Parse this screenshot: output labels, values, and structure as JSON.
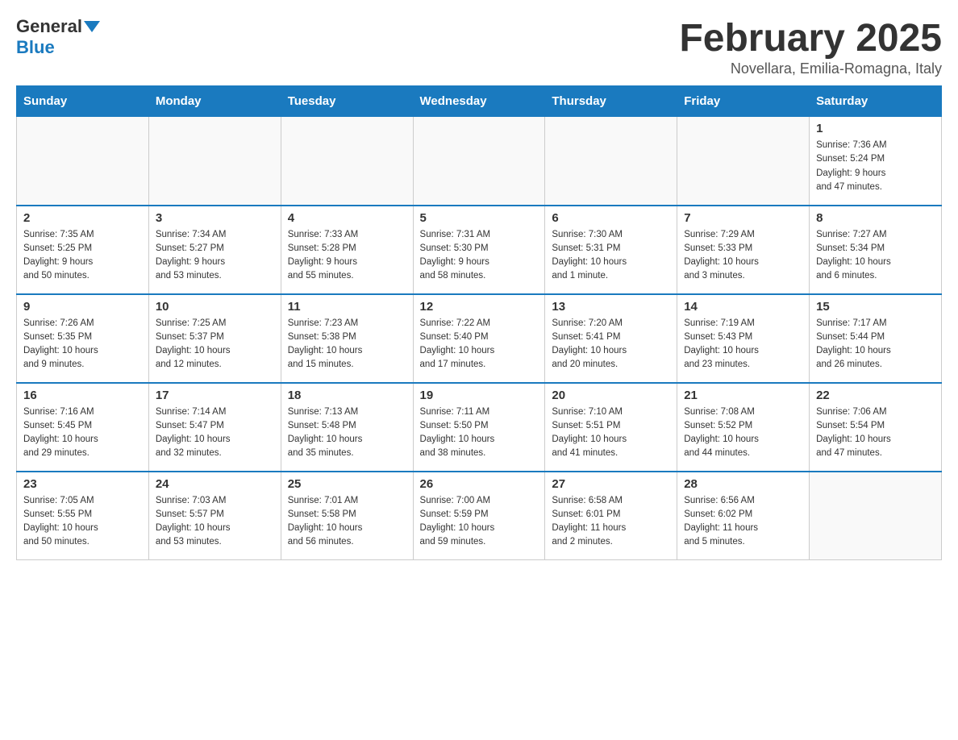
{
  "logo": {
    "general": "General",
    "blue": "Blue"
  },
  "title": "February 2025",
  "subtitle": "Novellara, Emilia-Romagna, Italy",
  "weekdays": [
    "Sunday",
    "Monday",
    "Tuesday",
    "Wednesday",
    "Thursday",
    "Friday",
    "Saturday"
  ],
  "weeks": [
    [
      {
        "day": "",
        "info": ""
      },
      {
        "day": "",
        "info": ""
      },
      {
        "day": "",
        "info": ""
      },
      {
        "day": "",
        "info": ""
      },
      {
        "day": "",
        "info": ""
      },
      {
        "day": "",
        "info": ""
      },
      {
        "day": "1",
        "info": "Sunrise: 7:36 AM\nSunset: 5:24 PM\nDaylight: 9 hours\nand 47 minutes."
      }
    ],
    [
      {
        "day": "2",
        "info": "Sunrise: 7:35 AM\nSunset: 5:25 PM\nDaylight: 9 hours\nand 50 minutes."
      },
      {
        "day": "3",
        "info": "Sunrise: 7:34 AM\nSunset: 5:27 PM\nDaylight: 9 hours\nand 53 minutes."
      },
      {
        "day": "4",
        "info": "Sunrise: 7:33 AM\nSunset: 5:28 PM\nDaylight: 9 hours\nand 55 minutes."
      },
      {
        "day": "5",
        "info": "Sunrise: 7:31 AM\nSunset: 5:30 PM\nDaylight: 9 hours\nand 58 minutes."
      },
      {
        "day": "6",
        "info": "Sunrise: 7:30 AM\nSunset: 5:31 PM\nDaylight: 10 hours\nand 1 minute."
      },
      {
        "day": "7",
        "info": "Sunrise: 7:29 AM\nSunset: 5:33 PM\nDaylight: 10 hours\nand 3 minutes."
      },
      {
        "day": "8",
        "info": "Sunrise: 7:27 AM\nSunset: 5:34 PM\nDaylight: 10 hours\nand 6 minutes."
      }
    ],
    [
      {
        "day": "9",
        "info": "Sunrise: 7:26 AM\nSunset: 5:35 PM\nDaylight: 10 hours\nand 9 minutes."
      },
      {
        "day": "10",
        "info": "Sunrise: 7:25 AM\nSunset: 5:37 PM\nDaylight: 10 hours\nand 12 minutes."
      },
      {
        "day": "11",
        "info": "Sunrise: 7:23 AM\nSunset: 5:38 PM\nDaylight: 10 hours\nand 15 minutes."
      },
      {
        "day": "12",
        "info": "Sunrise: 7:22 AM\nSunset: 5:40 PM\nDaylight: 10 hours\nand 17 minutes."
      },
      {
        "day": "13",
        "info": "Sunrise: 7:20 AM\nSunset: 5:41 PM\nDaylight: 10 hours\nand 20 minutes."
      },
      {
        "day": "14",
        "info": "Sunrise: 7:19 AM\nSunset: 5:43 PM\nDaylight: 10 hours\nand 23 minutes."
      },
      {
        "day": "15",
        "info": "Sunrise: 7:17 AM\nSunset: 5:44 PM\nDaylight: 10 hours\nand 26 minutes."
      }
    ],
    [
      {
        "day": "16",
        "info": "Sunrise: 7:16 AM\nSunset: 5:45 PM\nDaylight: 10 hours\nand 29 minutes."
      },
      {
        "day": "17",
        "info": "Sunrise: 7:14 AM\nSunset: 5:47 PM\nDaylight: 10 hours\nand 32 minutes."
      },
      {
        "day": "18",
        "info": "Sunrise: 7:13 AM\nSunset: 5:48 PM\nDaylight: 10 hours\nand 35 minutes."
      },
      {
        "day": "19",
        "info": "Sunrise: 7:11 AM\nSunset: 5:50 PM\nDaylight: 10 hours\nand 38 minutes."
      },
      {
        "day": "20",
        "info": "Sunrise: 7:10 AM\nSunset: 5:51 PM\nDaylight: 10 hours\nand 41 minutes."
      },
      {
        "day": "21",
        "info": "Sunrise: 7:08 AM\nSunset: 5:52 PM\nDaylight: 10 hours\nand 44 minutes."
      },
      {
        "day": "22",
        "info": "Sunrise: 7:06 AM\nSunset: 5:54 PM\nDaylight: 10 hours\nand 47 minutes."
      }
    ],
    [
      {
        "day": "23",
        "info": "Sunrise: 7:05 AM\nSunset: 5:55 PM\nDaylight: 10 hours\nand 50 minutes."
      },
      {
        "day": "24",
        "info": "Sunrise: 7:03 AM\nSunset: 5:57 PM\nDaylight: 10 hours\nand 53 minutes."
      },
      {
        "day": "25",
        "info": "Sunrise: 7:01 AM\nSunset: 5:58 PM\nDaylight: 10 hours\nand 56 minutes."
      },
      {
        "day": "26",
        "info": "Sunrise: 7:00 AM\nSunset: 5:59 PM\nDaylight: 10 hours\nand 59 minutes."
      },
      {
        "day": "27",
        "info": "Sunrise: 6:58 AM\nSunset: 6:01 PM\nDaylight: 11 hours\nand 2 minutes."
      },
      {
        "day": "28",
        "info": "Sunrise: 6:56 AM\nSunset: 6:02 PM\nDaylight: 11 hours\nand 5 minutes."
      },
      {
        "day": "",
        "info": ""
      }
    ]
  ]
}
